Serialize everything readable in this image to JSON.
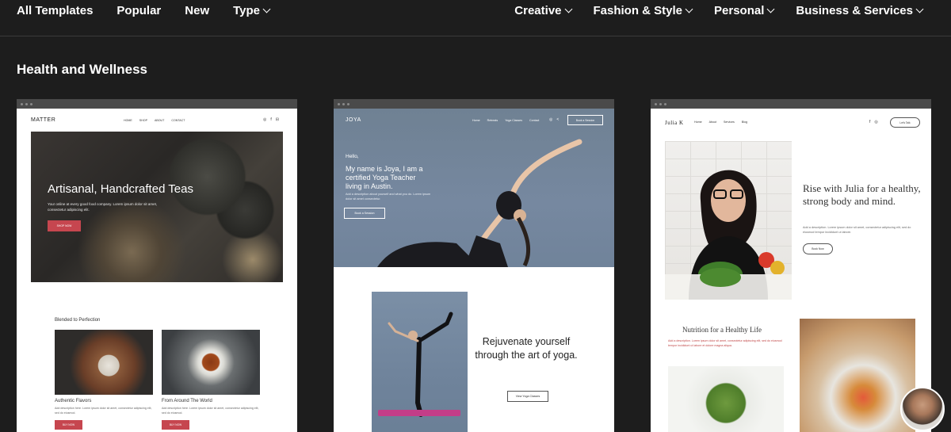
{
  "nav": {
    "left": [
      {
        "label": "All Templates",
        "dropdown": false
      },
      {
        "label": "Popular",
        "dropdown": false
      },
      {
        "label": "New",
        "dropdown": false
      },
      {
        "label": "Type",
        "dropdown": true
      }
    ],
    "right": [
      {
        "label": "Creative",
        "dropdown": true
      },
      {
        "label": "Fashion & Style",
        "dropdown": true
      },
      {
        "label": "Personal",
        "dropdown": true
      },
      {
        "label": "Business & Services",
        "dropdown": true
      }
    ]
  },
  "section": {
    "title": "Health and Wellness"
  },
  "templates": {
    "matter": {
      "logo": "MATTER",
      "links": [
        "Home",
        "Shop",
        "About",
        "Contact"
      ],
      "hero_title": "Artisanal, Handcrafted Teas",
      "hero_text": "Your online at every good food company. Lorem ipsum dolor sit amet, consectetur adipiscing elit.",
      "hero_button": "Shop Now",
      "subtitle": "Blended to Perfection",
      "tiles": [
        {
          "title": "Authentic Flavors",
          "text": "Add description here. Lorem ipsum dolor sit amet, consectetur adipiscing elit, sed do eiusmod.",
          "button": "Buy Now"
        },
        {
          "title": "From Around The World",
          "text": "Add description here. Lorem ipsum dolor sit amet, consectetur adipiscing elit, sed do eiusmod.",
          "button": "Buy Now"
        }
      ]
    },
    "joya": {
      "logo": "JOYA",
      "links": [
        "Home",
        "Retreats",
        "Yoga Classes",
        "Contact"
      ],
      "nav_button": "Book a Session",
      "hello": "Hello,",
      "headline": "My name is Joya, I am a certified Yoga Teacher living in Austin.",
      "lede": "Add a description about yourself and what you do. Lorem ipsum dolor sit amet consectetur.",
      "book_button": "Book a Session",
      "rejuvenate": "Rejuvenate yourself through the art of yoga.",
      "classes_button": "View Yoga Classes"
    },
    "julia": {
      "logo": "Julia K",
      "links": [
        "Home",
        "About",
        "Services",
        "Blog"
      ],
      "nav_button": "Let's Talk",
      "headline": "Rise with Julia for a healthy, strong body and mind.",
      "lede": "Add a description. Lorem ipsum dolor sit amet, consectetur adipiscing elit, sed do eiusmod tempor incididunt ut labore.",
      "book_button": "Book Now",
      "section_title": "Nutrition for a Healthy Life",
      "section_text": "Add a description. Lorem ipsum dolor sit amet, consectetur adipiscing elit, sed do eiusmod tempor incididunt ut labore et dolore magna aliqua."
    }
  },
  "colors": {
    "background": "#1d1d1d",
    "accent_red": "#c6464f",
    "joya_blue": "#7688a0",
    "mat_pink": "#c33d88"
  }
}
